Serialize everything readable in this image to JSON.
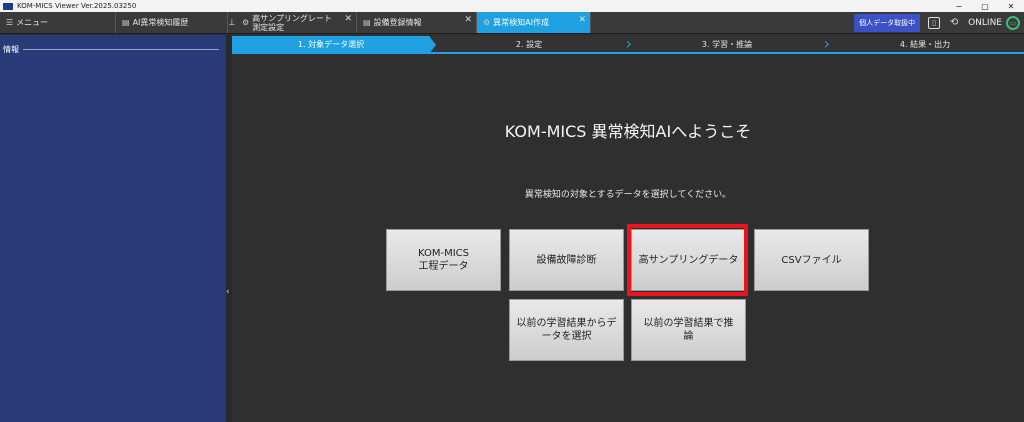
{
  "window": {
    "title": "KOM-MICS Viewer  Ver.2025.03250",
    "min": "−",
    "max": "▢",
    "close": "✕"
  },
  "tabs": {
    "menu": "メニュー",
    "history": "AI異常検知履歴",
    "sampling_line1": "高サンプリングレート",
    "sampling_line2": "測定設定",
    "device": "設備登録情報",
    "ai": "異常検知AI作成"
  },
  "header_right": {
    "badge": "個人データ取扱中",
    "status": "ONLINE"
  },
  "sidebar": {
    "title": "情報"
  },
  "steps": [
    "1. 対象データ選択",
    "2. 設定",
    "3. 学習・推論",
    "4. 結果・出力"
  ],
  "main": {
    "welcome": "KOM-MICS 異常検知AIへようこそ",
    "instruction": "異常検知の対象とするデータを選択してください。",
    "buttons": {
      "kommics": "KOM-MICS\n工程データ",
      "fault": "設備故障診断",
      "highsampling": "高サンプリングデータ",
      "csv": "CSVファイル",
      "prev_select": "以前の学習結果からデ\nータを選択",
      "prev_infer": "以前の学習結果で推\n論"
    }
  },
  "colors": {
    "accent": "#1fa0e0",
    "sidebar": "#283a78",
    "highlight": "#e8151b"
  },
  "icons": {
    "collapse": "‹"
  }
}
